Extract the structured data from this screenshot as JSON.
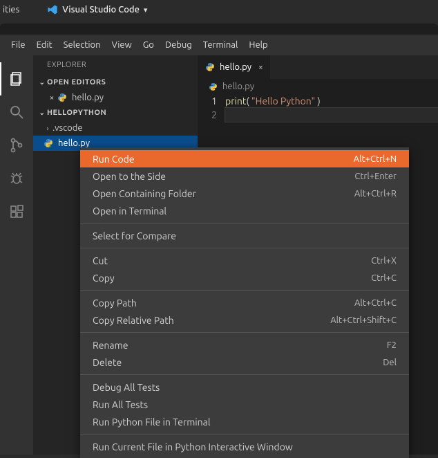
{
  "titlebar": {
    "left_label": "ities",
    "app_title": "Visual Studio Code"
  },
  "menubar": [
    "File",
    "Edit",
    "Selection",
    "View",
    "Go",
    "Debug",
    "Terminal",
    "Help"
  ],
  "sidebar": {
    "title": "EXPLORER",
    "open_editors_label": "OPEN EDITORS",
    "open_editors": [
      {
        "name": "hello.py"
      }
    ],
    "workspace_label": "HELLOPYTHON",
    "tree": {
      "folder": ".vscode",
      "file": "hello.py"
    }
  },
  "tab": {
    "name": "hello.py"
  },
  "breadcrumb": {
    "file": "hello.py"
  },
  "code": {
    "lines": [
      {
        "n": "1",
        "fn": "print",
        "open": "( ",
        "str": "\"Hello Python\"",
        "close": " )"
      },
      {
        "n": "2"
      }
    ]
  },
  "contextmenu": [
    {
      "label": "Run Code",
      "shortcut": "Alt+Ctrl+N",
      "hl": true
    },
    {
      "label": "Open to the Side",
      "shortcut": "Ctrl+Enter"
    },
    {
      "label": "Open Containing Folder",
      "shortcut": "Alt+Ctrl+R"
    },
    {
      "label": "Open in Terminal",
      "shortcut": ""
    },
    {
      "sep": true
    },
    {
      "label": "Select for Compare",
      "shortcut": ""
    },
    {
      "sep": true
    },
    {
      "label": "Cut",
      "shortcut": "Ctrl+X"
    },
    {
      "label": "Copy",
      "shortcut": "Ctrl+C"
    },
    {
      "sep": true
    },
    {
      "label": "Copy Path",
      "shortcut": "Alt+Ctrl+C"
    },
    {
      "label": "Copy Relative Path",
      "shortcut": "Alt+Ctrl+Shift+C"
    },
    {
      "sep": true
    },
    {
      "label": "Rename",
      "shortcut": "F2"
    },
    {
      "label": "Delete",
      "shortcut": "Del"
    },
    {
      "sep": true
    },
    {
      "label": "Debug All Tests",
      "shortcut": ""
    },
    {
      "label": "Run All Tests",
      "shortcut": ""
    },
    {
      "label": "Run Python File in Terminal",
      "shortcut": ""
    },
    {
      "sep": true
    },
    {
      "label": "Run Current File in Python Interactive Window",
      "shortcut": ""
    }
  ]
}
